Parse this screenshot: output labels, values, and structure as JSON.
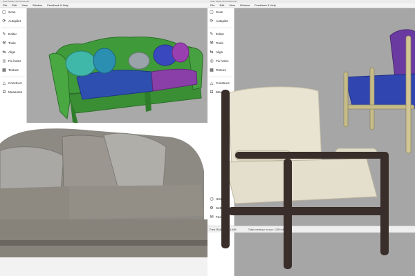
{
  "app": {
    "title": "Artec Studio 16 Professional",
    "menu": [
      "File",
      "Edit",
      "View",
      "Window",
      "Feedback & Help"
    ]
  },
  "sidebar": {
    "top": [
      {
        "label": "Scan",
        "icon": "scan-icon"
      },
      {
        "label": "Autopilot",
        "icon": "autopilot-icon"
      }
    ],
    "middle": [
      {
        "label": "Editor",
        "icon": "editor-icon"
      },
      {
        "label": "Tools",
        "icon": "tools-icon"
      },
      {
        "label": "Align",
        "icon": "align-icon"
      },
      {
        "label": "Fix holes",
        "icon": "fix-holes-icon"
      },
      {
        "label": "Texture",
        "icon": "texture-icon"
      }
    ],
    "bottom": [
      {
        "label": "Construct",
        "icon": "construct-icon"
      },
      {
        "label": "Measures",
        "icon": "measures-icon"
      }
    ],
    "footer": [
      {
        "label": "History",
        "icon": "history-icon"
      },
      {
        "label": "Settings",
        "icon": "settings-icon"
      },
      {
        "label": "Feedback",
        "icon": "feedback-icon"
      }
    ]
  },
  "status": {
    "free_ram": "Free RAM: 15994 MB",
    "total_memory": "Total memory in use: 1253 MB"
  },
  "colors": {
    "sofa_scan_green": "#3f9a3a",
    "sofa_scan_blue": "#2f4fb0",
    "sofa_scan_purple": "#8a3fa8",
    "chair_scan_purple": "#6a3aa0",
    "chair_frame": "#3a2e2a",
    "linen": "#e9e4d2"
  }
}
